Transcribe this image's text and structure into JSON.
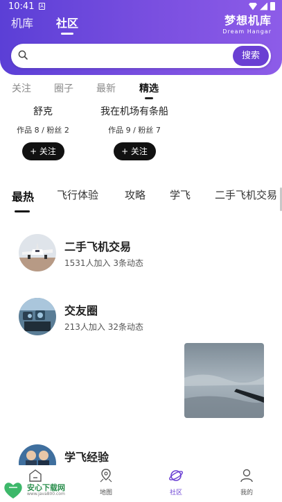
{
  "status": {
    "time": "10:41",
    "notif_icon": "A"
  },
  "header": {
    "tabs": [
      {
        "label": "机库"
      },
      {
        "label": "社区"
      }
    ],
    "brand": {
      "cn": "梦想机库",
      "en": "Dream Hangar"
    }
  },
  "search": {
    "placeholder": "",
    "button": "搜索"
  },
  "sub_tabs": [
    {
      "label": "关注"
    },
    {
      "label": "圈子"
    },
    {
      "label": "最新"
    },
    {
      "label": "精选"
    }
  ],
  "users": [
    {
      "name": "舒克",
      "stats": "作品 8 / 粉丝 2",
      "follow": "+ 关注"
    },
    {
      "name": "我在机场有条船",
      "stats": "作品 9 / 粉丝 7",
      "follow": "+ 关注"
    }
  ],
  "categories": [
    {
      "label": "最热"
    },
    {
      "label": "飞行体验"
    },
    {
      "label": "攻略"
    },
    {
      "label": "学飞"
    },
    {
      "label": "二手飞机交易"
    }
  ],
  "groups": [
    {
      "title": "二手飞机交易",
      "meta": "1531人加入  3条动态"
    },
    {
      "title": "交友圈",
      "meta": "213人加入  32条动态"
    },
    {
      "title": "学飞经验",
      "meta": ""
    }
  ],
  "bottom_nav": [
    {
      "label": "",
      "icon": "home-icon"
    },
    {
      "label": "地图",
      "icon": "map-icon"
    },
    {
      "label": "社区",
      "icon": "planet-icon"
    },
    {
      "label": "我的",
      "icon": "user-icon"
    }
  ],
  "watermark": {
    "title": "安心下载网",
    "url": "www.java800.com"
  },
  "colors": {
    "accent": "#6a3fd3",
    "header_start": "#5b3fd6",
    "header_end": "#8d5ce8"
  }
}
